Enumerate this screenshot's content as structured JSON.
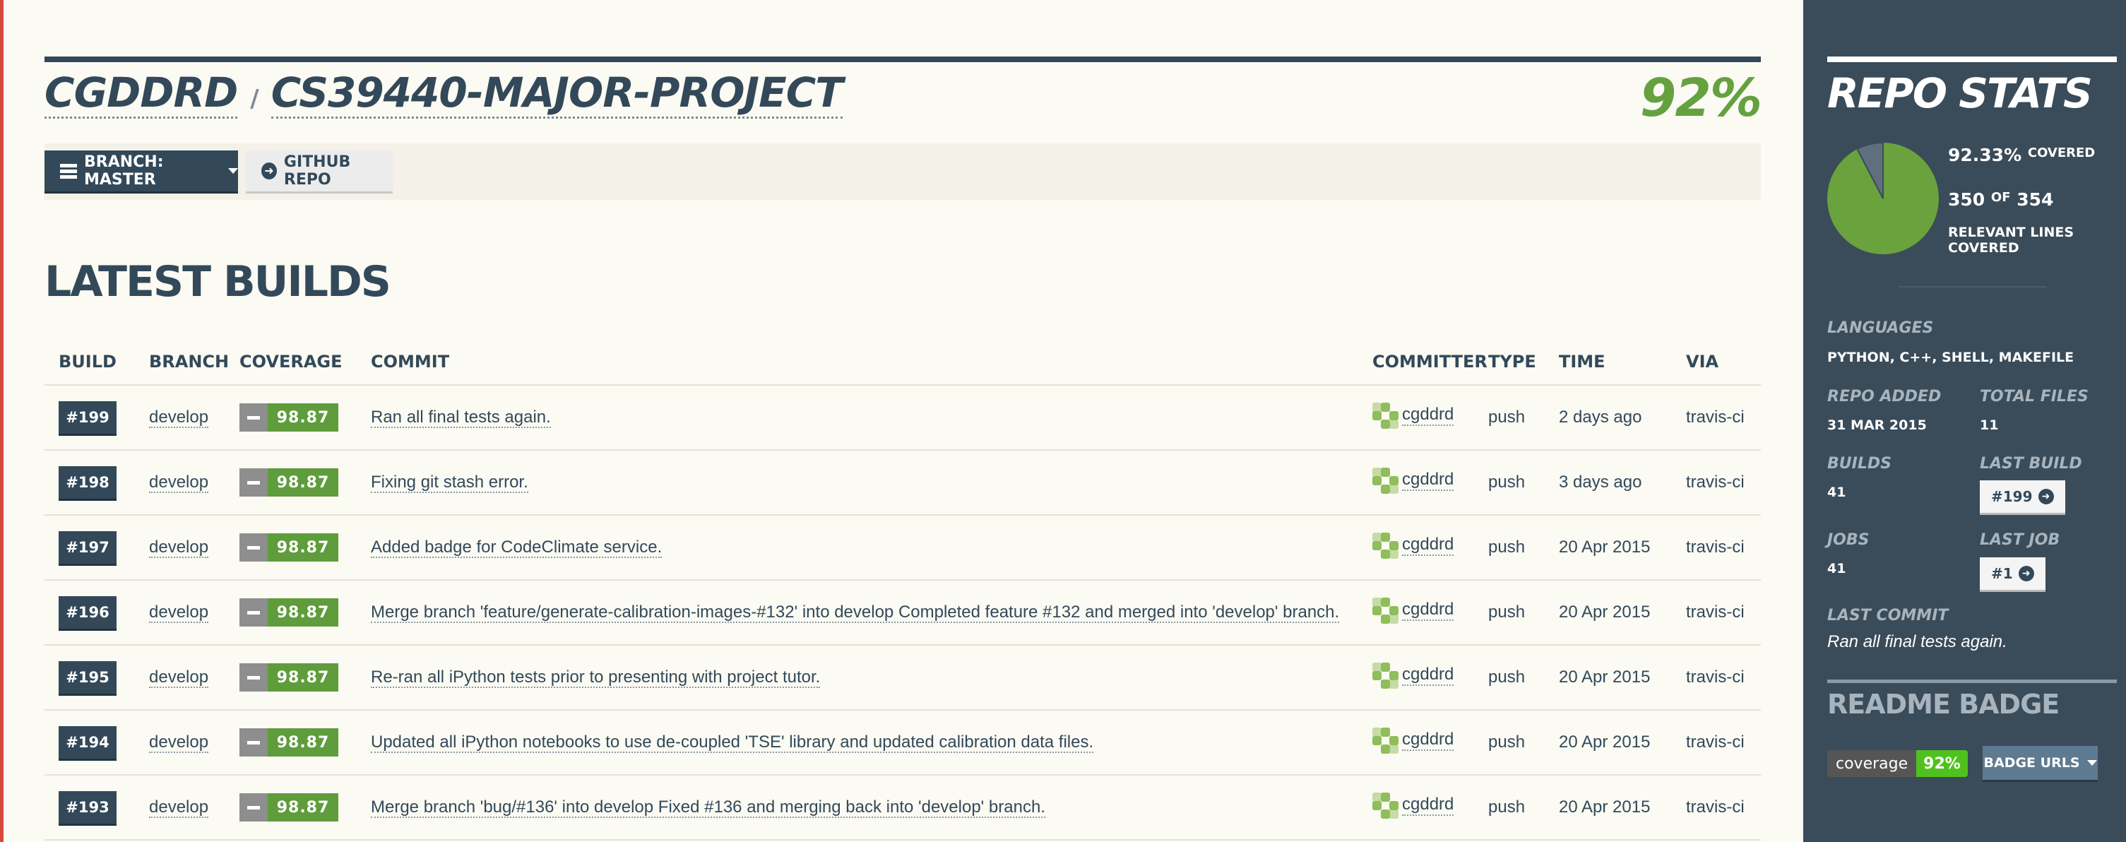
{
  "repo": {
    "owner": "CGDDRD",
    "separator": "/",
    "name": "CS39440-MAJOR-PROJECT",
    "coverage_pct": "92%"
  },
  "toolbar": {
    "branch_label": "BRANCH: MASTER",
    "github_label": "GITHUB REPO"
  },
  "builds_section": {
    "title": "LATEST BUILDS",
    "columns": [
      "BUILD",
      "BRANCH",
      "COVERAGE",
      "COMMIT",
      "COMMITTER",
      "TYPE",
      "TIME",
      "VIA"
    ],
    "rows": [
      {
        "build": "#199",
        "branch": "develop",
        "coverage": "98.87",
        "commit": "Ran all final tests again.",
        "committer": "cgddrd",
        "type": "push",
        "time": "2 days ago",
        "via": "travis-ci"
      },
      {
        "build": "#198",
        "branch": "develop",
        "coverage": "98.87",
        "commit": "Fixing git stash error.",
        "committer": "cgddrd",
        "type": "push",
        "time": "3 days ago",
        "via": "travis-ci"
      },
      {
        "build": "#197",
        "branch": "develop",
        "coverage": "98.87",
        "commit": "Added badge for CodeClimate service.",
        "committer": "cgddrd",
        "type": "push",
        "time": "20 Apr 2015",
        "via": "travis-ci"
      },
      {
        "build": "#196",
        "branch": "develop",
        "coverage": "98.87",
        "commit": "Merge branch 'feature/generate-calibration-images-#132' into develop Completed feature #132 and merged into 'develop' branch.",
        "committer": "cgddrd",
        "type": "push",
        "time": "20 Apr 2015",
        "via": "travis-ci"
      },
      {
        "build": "#195",
        "branch": "develop",
        "coverage": "98.87",
        "commit": "Re-ran all iPython tests prior to presenting with project tutor.",
        "committer": "cgddrd",
        "type": "push",
        "time": "20 Apr 2015",
        "via": "travis-ci"
      },
      {
        "build": "#194",
        "branch": "develop",
        "coverage": "98.87",
        "commit": "Updated all iPython notebooks to use de-coupled 'TSE' library and updated calibration data files.",
        "committer": "cgddrd",
        "type": "push",
        "time": "20 Apr 2015",
        "via": "travis-ci"
      },
      {
        "build": "#193",
        "branch": "develop",
        "coverage": "98.87",
        "commit": "Merge branch 'bug/#136' into develop Fixed #136 and merging back into 'develop' branch.",
        "committer": "cgddrd",
        "type": "push",
        "time": "20 Apr 2015",
        "via": "travis-ci"
      }
    ]
  },
  "sidebar": {
    "title": "REPO STATS",
    "covered_pct": "92.33%",
    "covered_word": "COVERED",
    "covered_fraction": 0.9233,
    "lines_covered": "350",
    "lines_of": "OF",
    "lines_total": "354",
    "relevant_label": "RELEVANT LINES COVERED",
    "languages_label": "LANGUAGES",
    "languages_value": "PYTHON, C++, SHELL, MAKEFILE",
    "repo_added_label": "REPO ADDED",
    "repo_added_value": "31 MAR 2015",
    "total_files_label": "TOTAL FILES",
    "total_files_value": "11",
    "builds_label": "BUILDS",
    "builds_value": "41",
    "last_build_label": "LAST BUILD",
    "last_build_value": "#199",
    "jobs_label": "JOBS",
    "jobs_value": "41",
    "last_job_label": "LAST JOB",
    "last_job_value": "#1",
    "last_commit_label": "LAST COMMIT",
    "last_commit_value": "Ran all final tests again.",
    "readme_title": "README BADGE",
    "badge_left": "coverage",
    "badge_right": "92%",
    "badge_urls_label": "BADGE URLS"
  },
  "colors": {
    "navy": "#33495a",
    "green": "#66a140",
    "sidebar_bg": "#3a4b59",
    "pie_covered": "#6aa23e",
    "pie_missed": "#5f6f7d"
  }
}
